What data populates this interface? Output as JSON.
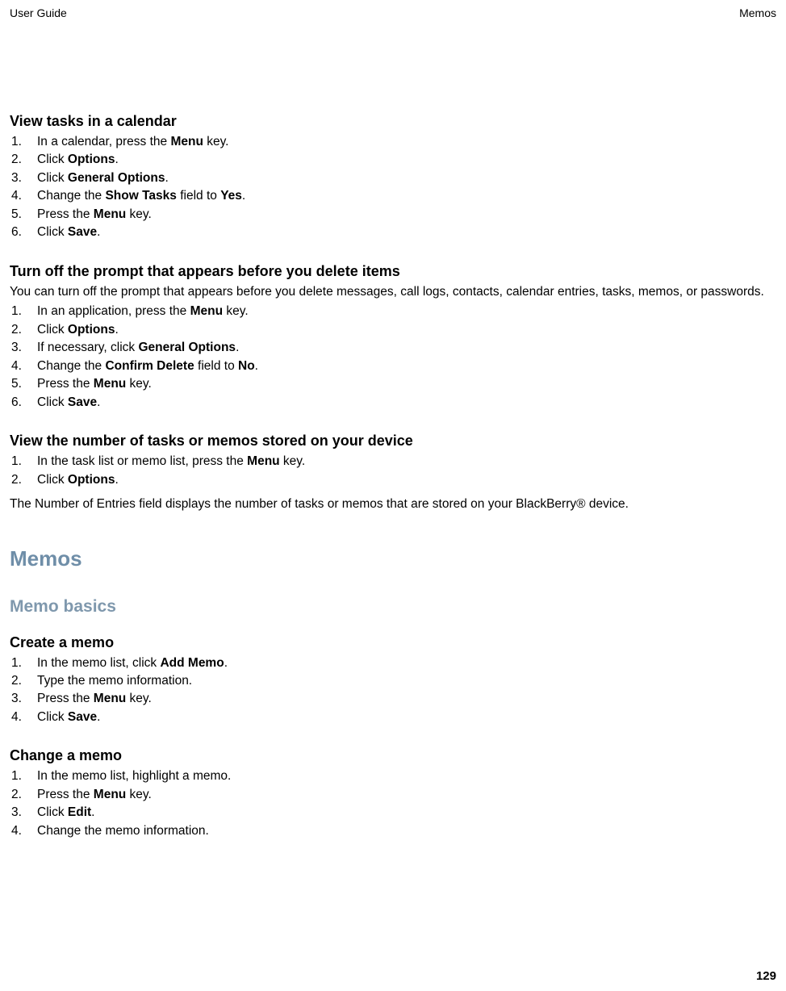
{
  "header": {
    "left": "User Guide",
    "right": "Memos"
  },
  "footer": {
    "page_number": "129"
  },
  "sections": {
    "view_tasks": {
      "title": "View tasks in a calendar",
      "steps": [
        [
          {
            "t": "In a calendar, press the "
          },
          {
            "t": "Menu",
            "b": true
          },
          {
            "t": " key."
          }
        ],
        [
          {
            "t": "Click "
          },
          {
            "t": "Options",
            "b": true
          },
          {
            "t": "."
          }
        ],
        [
          {
            "t": "Click "
          },
          {
            "t": "General Options",
            "b": true
          },
          {
            "t": "."
          }
        ],
        [
          {
            "t": "Change the "
          },
          {
            "t": "Show Tasks",
            "b": true
          },
          {
            "t": " field to "
          },
          {
            "t": "Yes",
            "b": true
          },
          {
            "t": "."
          }
        ],
        [
          {
            "t": "Press the "
          },
          {
            "t": "Menu",
            "b": true
          },
          {
            "t": " key."
          }
        ],
        [
          {
            "t": "Click "
          },
          {
            "t": "Save",
            "b": true
          },
          {
            "t": "."
          }
        ]
      ]
    },
    "turn_off_prompt": {
      "title": "Turn off the prompt that appears before you delete items",
      "intro": "You can turn off the prompt that appears before you delete messages, call logs, contacts, calendar entries, tasks, memos, or passwords.",
      "steps": [
        [
          {
            "t": "In an application, press the "
          },
          {
            "t": "Menu",
            "b": true
          },
          {
            "t": " key."
          }
        ],
        [
          {
            "t": "Click "
          },
          {
            "t": "Options",
            "b": true
          },
          {
            "t": "."
          }
        ],
        [
          {
            "t": "If necessary, click "
          },
          {
            "t": "General Options",
            "b": true
          },
          {
            "t": "."
          }
        ],
        [
          {
            "t": "Change the "
          },
          {
            "t": "Confirm Delete",
            "b": true
          },
          {
            "t": " field to "
          },
          {
            "t": "No",
            "b": true
          },
          {
            "t": "."
          }
        ],
        [
          {
            "t": "Press the "
          },
          {
            "t": "Menu",
            "b": true
          },
          {
            "t": " key."
          }
        ],
        [
          {
            "t": "Click "
          },
          {
            "t": "Save",
            "b": true
          },
          {
            "t": "."
          }
        ]
      ]
    },
    "view_number": {
      "title": "View the number of tasks or memos stored on your device",
      "steps": [
        [
          {
            "t": "In the task list or memo list, press the "
          },
          {
            "t": "Menu",
            "b": true
          },
          {
            "t": " key."
          }
        ],
        [
          {
            "t": "Click "
          },
          {
            "t": "Options",
            "b": true
          },
          {
            "t": "."
          }
        ]
      ],
      "outro": "The Number of Entries field displays the number of tasks or memos that are stored on your BlackBerry® device."
    },
    "memos_h1": "Memos",
    "memo_basics_h2": "Memo basics",
    "create_memo": {
      "title": "Create a memo",
      "steps": [
        [
          {
            "t": "In the memo list, click "
          },
          {
            "t": "Add Memo",
            "b": true
          },
          {
            "t": "."
          }
        ],
        [
          {
            "t": "Type the memo information."
          }
        ],
        [
          {
            "t": "Press the "
          },
          {
            "t": "Menu",
            "b": true
          },
          {
            "t": " key."
          }
        ],
        [
          {
            "t": "Click "
          },
          {
            "t": "Save",
            "b": true
          },
          {
            "t": "."
          }
        ]
      ]
    },
    "change_memo": {
      "title": "Change a memo",
      "steps": [
        [
          {
            "t": "In the memo list, highlight a memo."
          }
        ],
        [
          {
            "t": "Press the "
          },
          {
            "t": "Menu",
            "b": true
          },
          {
            "t": " key."
          }
        ],
        [
          {
            "t": "Click "
          },
          {
            "t": "Edit",
            "b": true
          },
          {
            "t": "."
          }
        ],
        [
          {
            "t": "Change the memo information."
          }
        ]
      ]
    }
  }
}
